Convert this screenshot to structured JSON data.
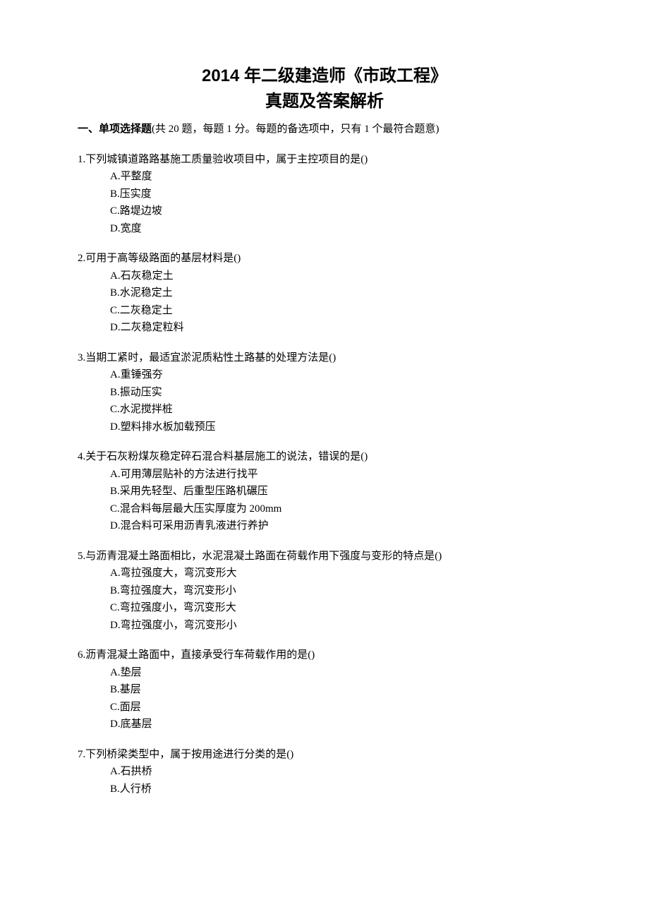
{
  "title": {
    "line1": "2014 年二级建造师《市政工程》",
    "line2": "真题及答案解析"
  },
  "section": {
    "label": "一、单项选择题",
    "desc": "(共 20 题，每题 1 分。每题的备选项中，只有 1 个最符合题意)"
  },
  "questions": [
    {
      "stem": "1.下列城镇道路路基施工质量验收项目中，属于主控项目的是()",
      "options": [
        "A.平整度",
        "B.压实度",
        "C.路堤边坡",
        "D.宽度"
      ]
    },
    {
      "stem": "2.可用于高等级路面的基层材料是()",
      "options": [
        "A.石灰稳定土",
        "B.水泥稳定土",
        "C.二灰稳定土",
        "D.二灰稳定粒料"
      ]
    },
    {
      "stem": "3.当期工紧时，最适宜淤泥质粘性土路基的处理方法是()",
      "options": [
        "A.重锤强夯",
        "B.振动压实",
        "C.水泥搅拌桩",
        "D.塑料排水板加载预压"
      ]
    },
    {
      "stem": "4.关于石灰粉煤灰稳定碎石混合料基层施工的说法，错误的是()",
      "options": [
        "A.可用薄层贴补的方法进行找平",
        "B.采用先轻型、后重型压路机碾压",
        "C.混合料每层最大压实厚度为 200mm",
        "D.混合料可采用沥青乳液进行养护"
      ]
    },
    {
      "stem": "5.与沥青混凝土路面相比，水泥混凝土路面在荷载作用下强度与变形的特点是()",
      "options": [
        "A.弯拉强度大，弯沉变形大",
        "B.弯拉强度大，弯沉变形小",
        "C.弯拉强度小，弯沉变形大",
        "D.弯拉强度小，弯沉变形小"
      ]
    },
    {
      "stem": "6.沥青混凝土路面中，直接承受行车荷载作用的是()",
      "options": [
        "A.垫层",
        "B.基层",
        "C.面层",
        "D.底基层"
      ]
    },
    {
      "stem": "7.下列桥梁类型中，属于按用途进行分类的是()",
      "options": [
        "A.石拱桥",
        "B.人行桥"
      ]
    }
  ]
}
